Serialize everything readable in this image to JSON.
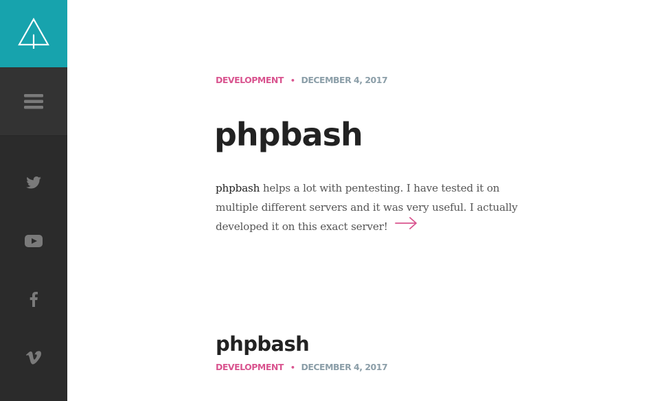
{
  "sidebar": {
    "logo_icon": "triangle-tree-logo-icon",
    "menu_icon": "hamburger-menu-icon",
    "social": [
      {
        "name": "twitter-icon"
      },
      {
        "name": "youtube-icon"
      },
      {
        "name": "facebook-icon"
      },
      {
        "name": "vimeo-icon"
      }
    ],
    "colors": {
      "logo_bg": "#17a3ad",
      "sidebar_bg": "#2b2b2b",
      "menu_bg": "#333333",
      "icon": "#7a7a7a"
    }
  },
  "posts": [
    {
      "category": "DEVELOPMENT",
      "separator": "•",
      "date": "DECEMBER 4, 2017",
      "title": "phpbash",
      "excerpt_lead": "phpbash",
      "excerpt_rest": " helps a lot with pentesting. I have tested it on multiple different servers and it was very useful. I actually developed it on this exact server!",
      "read_more_icon": "arrow-right-icon"
    },
    {
      "title": "phpbash",
      "category": "DEVELOPMENT",
      "separator": "•",
      "date": "DECEMBER 4, 2017"
    }
  ],
  "colors": {
    "accent": "#d9548f",
    "date": "#8b9ea8",
    "title": "#222222"
  }
}
